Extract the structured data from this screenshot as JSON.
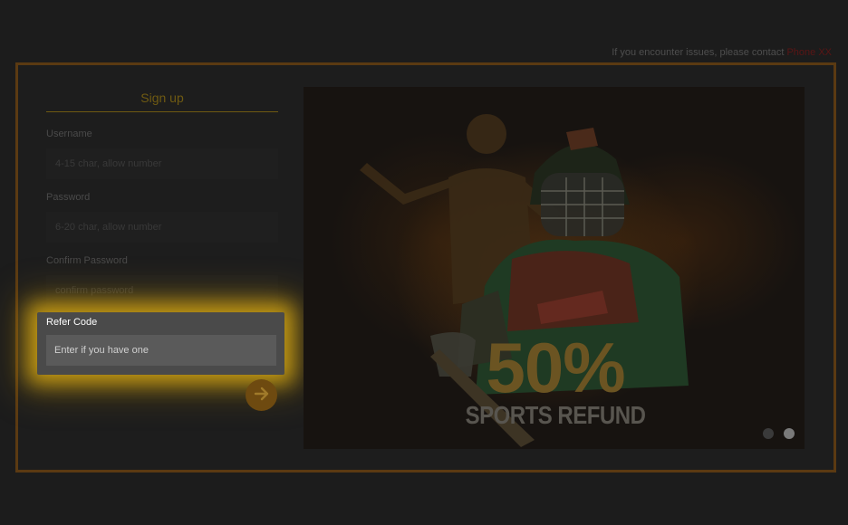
{
  "contact": {
    "text": "If you encounter issues, please contact",
    "link": "Phone XX"
  },
  "form": {
    "title": "Sign up",
    "username": {
      "label": "Username",
      "placeholder": "4-15 char, allow number"
    },
    "password": {
      "label": "Password",
      "placeholder": "6-20 char, allow number"
    },
    "confirm_password": {
      "label": "Confirm Password",
      "placeholder": "confirm password"
    },
    "refer_code": {
      "label": "Refer Code",
      "placeholder": "Enter if you have one"
    },
    "submit_icon": "arrow-right-icon"
  },
  "banner": {
    "headline": "50%",
    "subheadline": "SPORTS REFUND",
    "slide_count": 2,
    "active_slide": 2
  },
  "colors": {
    "accent": "#e6b414",
    "frame": "#5b3a12",
    "submit": "#6e4a10"
  }
}
